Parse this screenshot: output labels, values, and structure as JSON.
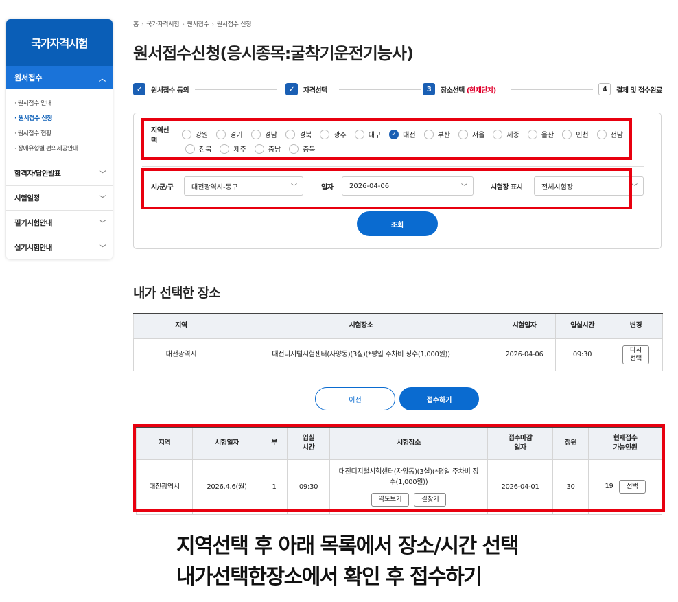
{
  "sidebar": {
    "title": "국가자격시험",
    "active": "원서접수",
    "sub_items": [
      "원서접수 안내",
      "원서접수 신청",
      "원서접수 현황",
      "장애유형별 편의제공안내"
    ],
    "items": [
      "합격자/답안발표",
      "시험일정",
      "필기시험안내",
      "실기시험안내"
    ]
  },
  "breadcrumb": [
    "홈",
    "국가자격시험",
    "원서접수",
    "원서접수 신청"
  ],
  "page_title": "원서접수신청(응시종목:굴착기운전기능사)",
  "steps": [
    {
      "mark": "✓",
      "label": "원서접수 동의"
    },
    {
      "mark": "✓",
      "label": "자격선택"
    },
    {
      "mark": "3",
      "label": "장소선택",
      "current": "(현재단계)"
    },
    {
      "mark": "4",
      "label": "결제 및 접수완료"
    }
  ],
  "filter": {
    "region_label": "지역선택",
    "regions_row1": [
      "강원",
      "경기",
      "경남",
      "경북",
      "광주",
      "대구",
      "대전",
      "부산",
      "서울",
      "세종",
      "울산",
      "인천",
      "전남"
    ],
    "regions_row2": [
      "전북",
      "제주",
      "충남",
      "충북"
    ],
    "selected_region": "대전",
    "district_label": "시/군/구",
    "district_value": "대전광역시-동구",
    "date_label": "일자",
    "date_value": "2026-04-06",
    "venue_label": "시험장 표시",
    "venue_value": "전체시험장",
    "search_button": "조회"
  },
  "my_selection": {
    "heading": "내가 선택한 장소",
    "headers": [
      "지역",
      "시험장소",
      "시험일자",
      "입실시간",
      "변경"
    ],
    "row": {
      "region": "대전광역시",
      "place": "대전디지털시험센터(자양동)(3실)(*평일 주차비 징수(1,000원))",
      "date": "2026-04-06",
      "time": "09:30",
      "change_button": "다시\n선택"
    }
  },
  "actions": {
    "prev": "이전",
    "submit": "접수하기"
  },
  "schedule": {
    "headers": [
      "지역",
      "시험일자",
      "부",
      "입실\n시간",
      "시험장소",
      "접수마감\n일자",
      "정원",
      "현재접수\n가능인원"
    ],
    "row": {
      "region": "대전광역시",
      "date": "2026.4.6(월)",
      "part": "1",
      "time": "09:30",
      "place": "대전디지털시험센터(자양동)(3실)(*평일 주차비 징수(1,000원))",
      "map_button": "약도보기",
      "directions_button": "길찾기",
      "deadline": "2026-04-01",
      "capacity": "30",
      "available": "19",
      "select_button": "선택"
    }
  },
  "caption": {
    "line1": "지역선택 후 아래 목록에서 장소/시간 선택",
    "line2": "내가선택한장소에서 확인 후 접수하기"
  },
  "colors": {
    "primary": "#0a6bd0",
    "highlight": "#e8000f",
    "current_step": "#e0002b"
  }
}
